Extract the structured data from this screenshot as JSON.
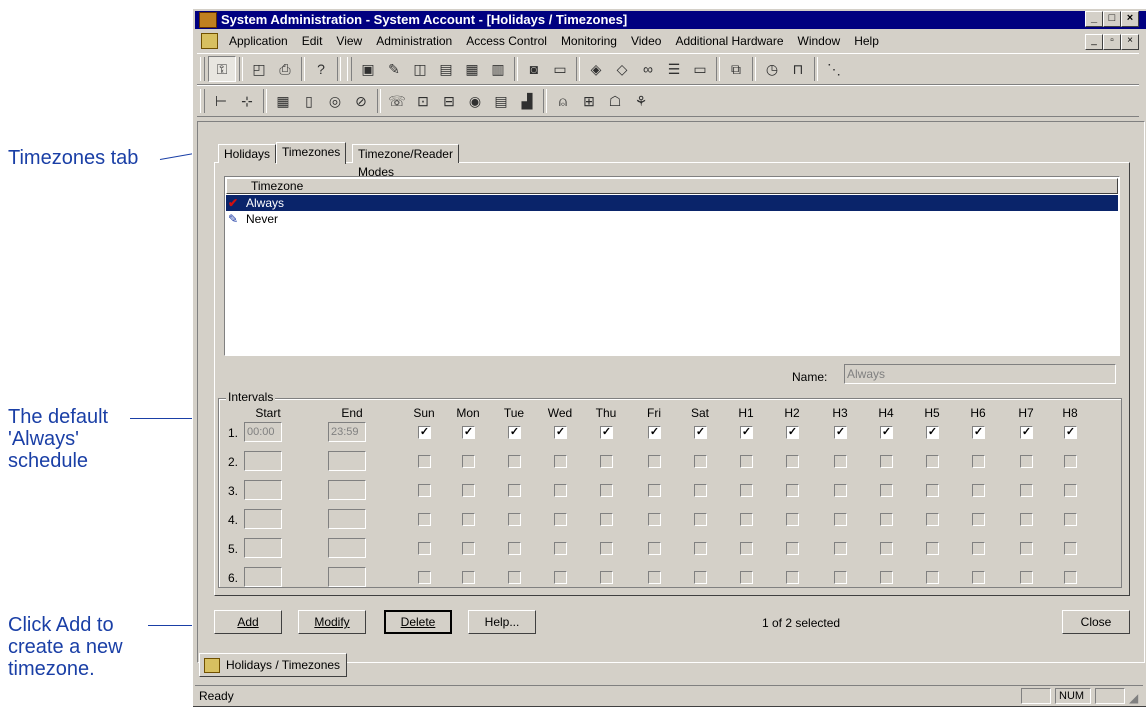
{
  "callouts": {
    "timezones_tab": "Timezones tab",
    "default_line1": "The default",
    "default_line2": "'Always'",
    "default_line3": "schedule",
    "add_line1": "Click Add to",
    "add_line2": "create a new",
    "add_line3": "timezone."
  },
  "window": {
    "title": "System Administration - System Account - [Holidays / Timezones]"
  },
  "menu": [
    "Application",
    "Edit",
    "View",
    "Administration",
    "Access Control",
    "Monitoring",
    "Video",
    "Additional Hardware",
    "Window",
    "Help"
  ],
  "tabs": [
    "Holidays",
    "Timezones",
    "Timezone/Reader Modes"
  ],
  "list": {
    "header": "Timezone",
    "items": [
      "Always",
      "Never"
    ]
  },
  "name_field": {
    "label": "Name:",
    "value": "Always"
  },
  "intervals": {
    "label": "Intervals",
    "columns": [
      "Start",
      "End",
      "Sun",
      "Mon",
      "Tue",
      "Wed",
      "Thu",
      "Fri",
      "Sat",
      "H1",
      "H2",
      "H3",
      "H4",
      "H5",
      "H6",
      "H7",
      "H8"
    ],
    "rows": [
      {
        "num": "1.",
        "start": "00:00",
        "end": "23:59",
        "checked": true
      },
      {
        "num": "2.",
        "start": "",
        "end": "",
        "checked": false
      },
      {
        "num": "3.",
        "start": "",
        "end": "",
        "checked": false
      },
      {
        "num": "4.",
        "start": "",
        "end": "",
        "checked": false
      },
      {
        "num": "5.",
        "start": "",
        "end": "",
        "checked": false
      },
      {
        "num": "6.",
        "start": "",
        "end": "",
        "checked": false
      }
    ]
  },
  "buttons": {
    "add": "Add",
    "modify": "Modify",
    "delete": "Delete",
    "help": "Help...",
    "close": "Close"
  },
  "selection_status": "1 of 2 selected",
  "mdi_tab": "Holidays / Timezones",
  "status": {
    "text": "Ready",
    "num": "NUM"
  },
  "colors": {
    "title_bg": "#000080",
    "selection_bg": "#0a246a",
    "callout": "#1a3fa6",
    "face": "#d4d0c8"
  }
}
